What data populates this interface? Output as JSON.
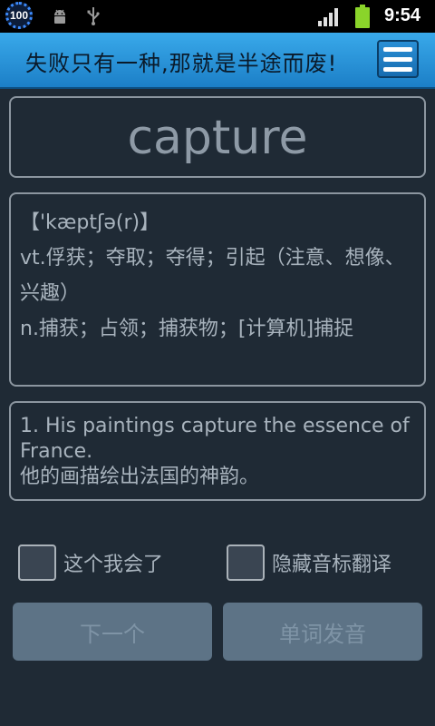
{
  "status_bar": {
    "battery_badge": "100",
    "time": "9:54",
    "icons": [
      "battery-badge-icon",
      "android-debug-icon",
      "usb-icon",
      "signal-icon",
      "battery-icon"
    ]
  },
  "header": {
    "motto": "失败只有一种,那就是半途而废!",
    "menu_icon": "hamburger-menu-icon",
    "colors": {
      "top": "#39a9ea",
      "bottom": "#1c7fc7"
    }
  },
  "word": {
    "text": "capture"
  },
  "definition": {
    "phonetic": "【'kæptʃə(r)】",
    "lines": [
      " vt.俘获；夺取；夺得；引起（注意、想像、兴趣）",
      "n.捕获；占领；捕获物；[计算机]捕捉"
    ]
  },
  "example": {
    "english": "1. His paintings capture the essence of France.",
    "chinese": "他的画描绘出法国的神韵。"
  },
  "options": {
    "know_it": {
      "label": "这个我会了",
      "checked": false
    },
    "hide_phonetic": {
      "label": "隐藏音标翻译",
      "checked": false
    }
  },
  "buttons": {
    "next": "下一个",
    "pronounce": "单词发音"
  },
  "colors": {
    "background": "#1f2a35",
    "panel_border": "#8c96a0",
    "text": "#a8b3bd",
    "button": "#5d7386"
  }
}
